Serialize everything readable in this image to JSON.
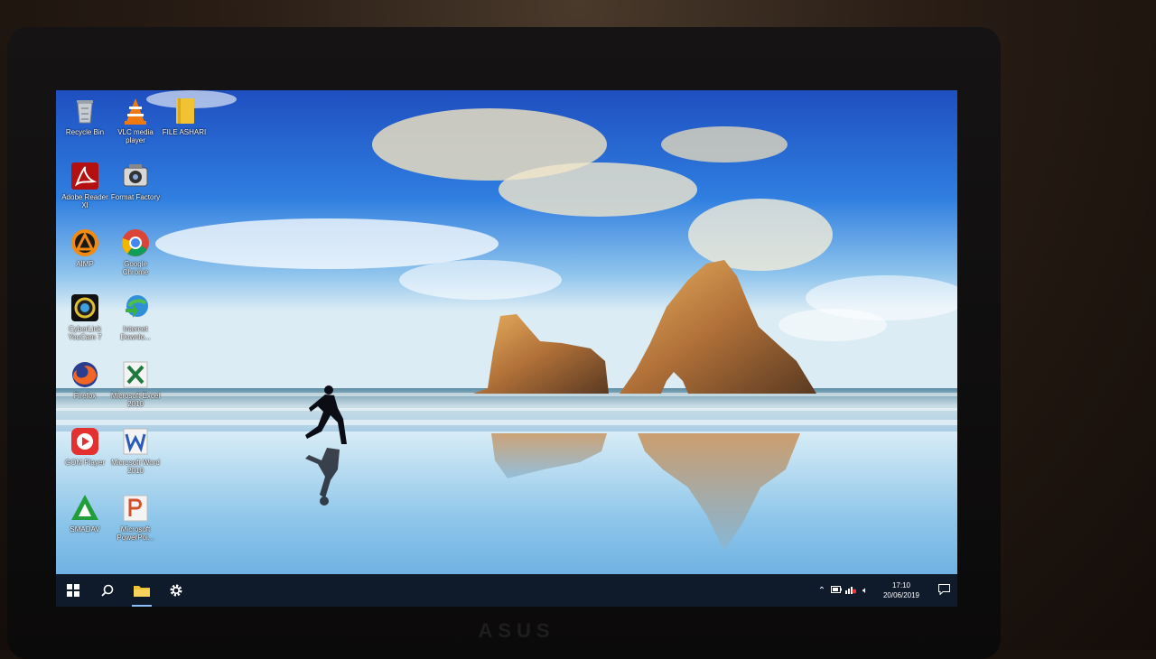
{
  "desktop": {
    "icons": [
      {
        "label": "Recycle Bin",
        "icon": "recycle-bin-icon"
      },
      {
        "label": "VLC media player",
        "icon": "vlc-icon"
      },
      {
        "label": "FILE ASHARI",
        "icon": "folder-icon"
      },
      {
        "label": "Adobe Reader XI",
        "icon": "adobe-reader-icon"
      },
      {
        "label": "Format Factory",
        "icon": "format-factory-icon"
      },
      {
        "label": "AIMP",
        "icon": "aimp-icon"
      },
      {
        "label": "Google Chrome",
        "icon": "chrome-icon"
      },
      {
        "label": "CyberLink YouCam 7",
        "icon": "youcam-icon"
      },
      {
        "label": "Internet Downlo...",
        "icon": "idm-icon"
      },
      {
        "label": "Firefox",
        "icon": "firefox-icon"
      },
      {
        "label": "Microsoft Excel 2010",
        "icon": "excel-icon"
      },
      {
        "label": "GOM Player",
        "icon": "gom-player-icon"
      },
      {
        "label": "Microsoft Word 2010",
        "icon": "word-icon"
      },
      {
        "label": "SMADAV",
        "icon": "smadav-icon"
      },
      {
        "label": "Microsoft PowerPoi...",
        "icon": "powerpoint-icon"
      }
    ]
  },
  "taskbar": {
    "start_icon": "windows-start-icon",
    "search_icon": "search-icon",
    "explorer_icon": "file-explorer-icon",
    "settings_icon": "gear-icon",
    "tray": {
      "time": "17:10",
      "date": "20/06/2019"
    }
  },
  "hardware": {
    "brand": "ASUS"
  },
  "colors": {
    "taskbar": "#0f1a2b",
    "accent": "#8ac0ff"
  }
}
